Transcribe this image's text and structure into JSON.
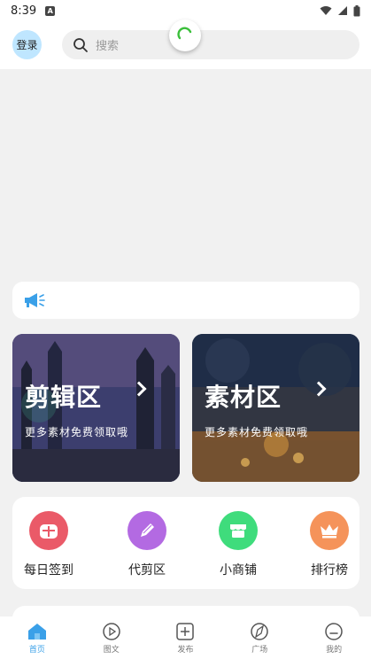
{
  "status_bar": {
    "time": "8:39",
    "notification_icon": "A"
  },
  "header": {
    "login_label": "登录",
    "search_placeholder": "搜索"
  },
  "cards": [
    {
      "title": "剪辑区",
      "subtitle": "更多素材免费领取哦"
    },
    {
      "title": "素材区",
      "subtitle": "更多素材免费领取哦"
    }
  ],
  "quick_actions": [
    {
      "label": "每日签到",
      "icon": "calendar-icon",
      "color": "#ea5a68"
    },
    {
      "label": "代剪区",
      "icon": "pencil-icon",
      "color": "#b36ae2"
    },
    {
      "label": "小商铺",
      "icon": "shop-icon",
      "color": "#3fdc7c"
    },
    {
      "label": "排行榜",
      "icon": "crown-icon",
      "color": "#f5935a"
    }
  ],
  "bottom_nav": [
    {
      "label": "首页",
      "icon": "home-icon",
      "active": true
    },
    {
      "label": "图文",
      "icon": "play-icon",
      "active": false
    },
    {
      "label": "发布",
      "icon": "plus-icon",
      "active": false
    },
    {
      "label": "广场",
      "icon": "compass-icon",
      "active": false
    },
    {
      "label": "我的",
      "icon": "user-icon",
      "active": false
    }
  ],
  "colors": {
    "accent": "#3aa0e8",
    "loader": "#3bbf3b"
  }
}
